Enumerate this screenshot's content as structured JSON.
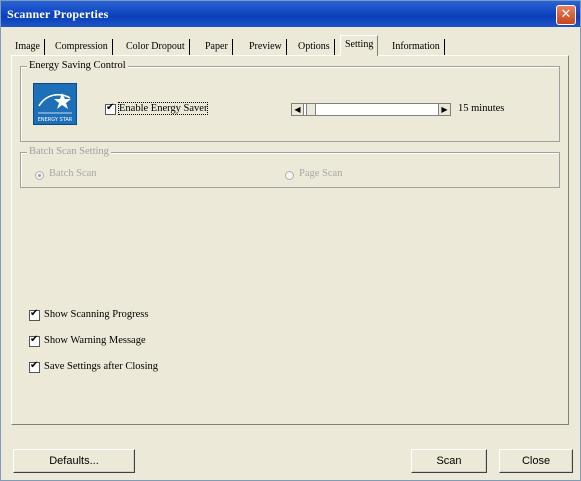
{
  "window": {
    "title": "Scanner Properties",
    "close_glyph": "✕"
  },
  "tabs": [
    {
      "label": "Image"
    },
    {
      "label": "Compression"
    },
    {
      "label": "Color Dropout"
    },
    {
      "label": "Paper"
    },
    {
      "label": "Preview"
    },
    {
      "label": "Options"
    },
    {
      "label": "Setting",
      "active": true
    },
    {
      "label": "Information"
    }
  ],
  "energy": {
    "legend": "Energy Saving Control",
    "logo_label": "ENERGY STAR",
    "enable_label": "Enable Energy Saver",
    "enable_checked": true,
    "value_text": "15 minutes"
  },
  "batch": {
    "legend": "Batch Scan Setting",
    "option_batch": "Batch Scan",
    "option_page": "Page Scan"
  },
  "options": {
    "show_progress": "Show Scanning Progress",
    "show_warning": "Show Warning Message",
    "save_settings": "Save Settings after Closing"
  },
  "buttons": {
    "defaults": "Defaults...",
    "scan": "Scan",
    "close": "Close"
  },
  "icons": {
    "check": "✔",
    "arrow_left": "◀",
    "arrow_right": "▶"
  }
}
